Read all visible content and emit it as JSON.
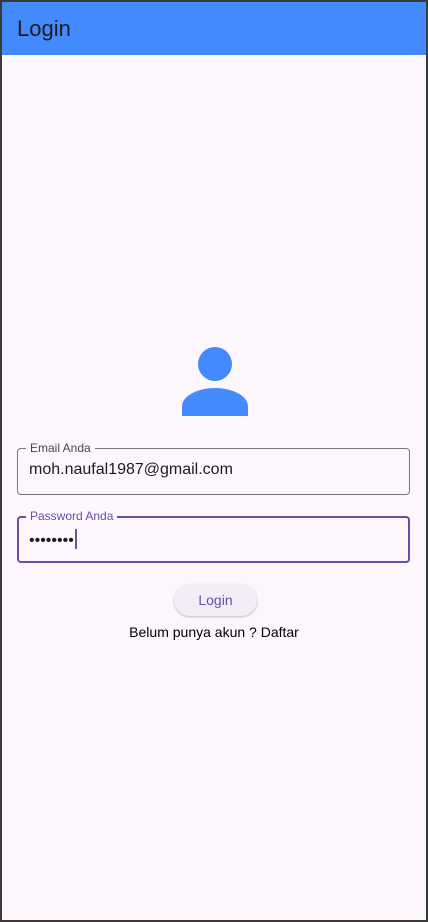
{
  "app_bar": {
    "title": "Login",
    "color": "#448aff"
  },
  "avatar": {
    "icon": "person-icon",
    "color": "#448aff"
  },
  "email_field": {
    "label": "Email Anda",
    "value": "moh.naufal1987@gmail.com"
  },
  "password_field": {
    "label": "Password Anda",
    "value": "••••••••",
    "focused": true,
    "accent_color": "#6750a4"
  },
  "login_button": {
    "label": "Login"
  },
  "register": {
    "prompt": "Belum punya akun ?",
    "link": "Daftar"
  }
}
